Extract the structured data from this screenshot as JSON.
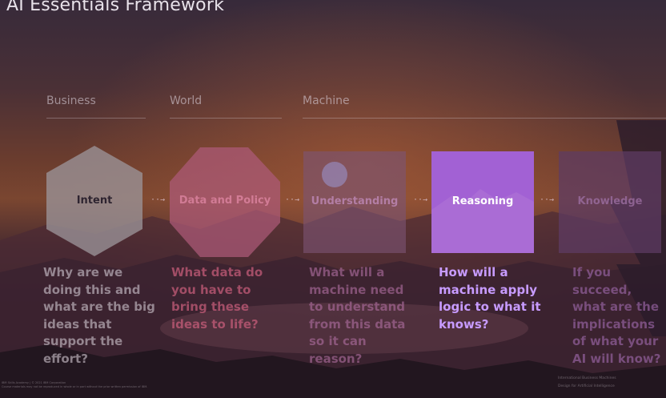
{
  "title": "AI Essentials Framework",
  "categories": {
    "business": "Business",
    "world": "World",
    "machine": "Machine"
  },
  "steps": [
    {
      "label": "Intent",
      "question": "Why are we doing this and what are the big ideas that support the effort?"
    },
    {
      "label": "Data and Policy",
      "question": "What data do you have to bring these ideas to life?"
    },
    {
      "label": "Understanding",
      "question": "What will a machine need to understand from this data so it can reason?"
    },
    {
      "label": "Reasoning",
      "question": "How will a machine apply logic to what it knows?"
    },
    {
      "label": "Knowledge",
      "question": "If you succeed, what are the implications of what your AI will know?"
    }
  ],
  "arrow_glyph": "··→",
  "footer_left": [
    "IBM Skills Academy | © 2021 IBM Corporation",
    "Course materials may not be reproduced in whole or in part without the prior written permission of IBM."
  ],
  "footer_right": [
    "International Business Machines",
    "Design for Artificial Intelligence"
  ],
  "colors": {
    "active_fill": "#a261d4",
    "active_text": "#c79bff",
    "intent_fill": "#9b9498",
    "policy_fill": "#ad5a79",
    "understanding_fill": "#7c5474",
    "knowledge_fill": "#5e3b64"
  }
}
